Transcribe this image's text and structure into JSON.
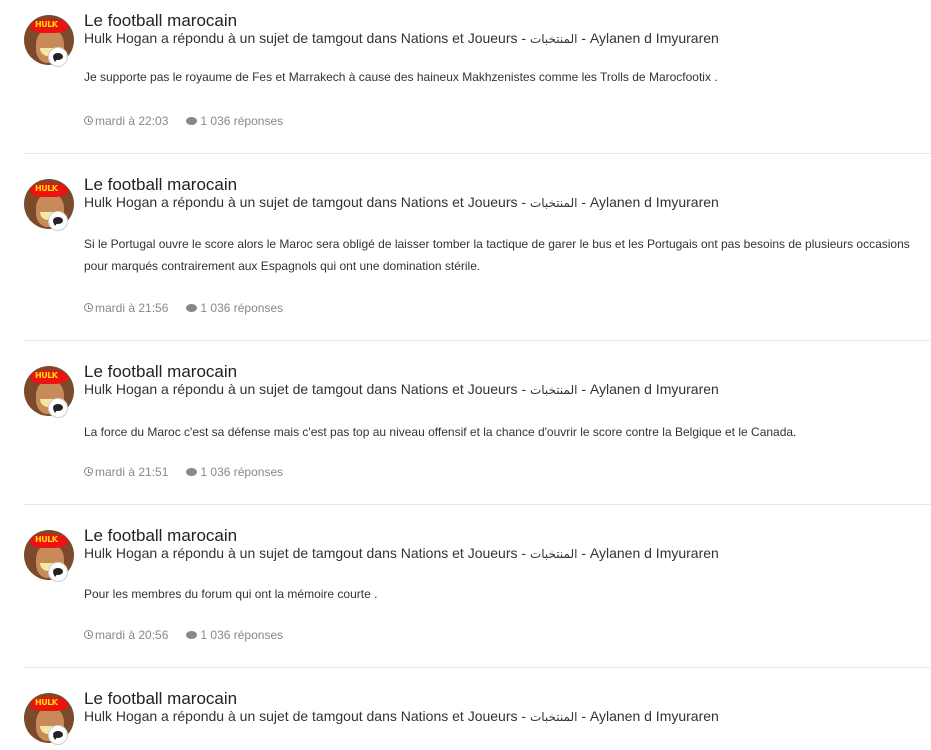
{
  "avatar_band_text": "HULK",
  "items": [
    {
      "forum": "Le football marocain",
      "summary": "Hulk Hogan a répondu à un sujet de tamgout dans Nations et Joueurs - ",
      "summary_ar": "المنتخبات",
      "summary_end": " - Aylanen d Imyuraren",
      "excerpt": "Je supporte pas le royaume de Fes et Marrakech à cause des haineux Makhzenistes comme les Trolls de Marocfootix .",
      "time": "mardi à 22:03",
      "replies": "1 036 réponses"
    },
    {
      "forum": "Le football marocain",
      "summary": "Hulk Hogan a répondu à un sujet de tamgout dans Nations et Joueurs - ",
      "summary_ar": "المنتخبات",
      "summary_end": " - Aylanen d Imyuraren",
      "excerpt": "Si le Portugal ouvre le score alors le Maroc sera obligé de laisser tomber la tactique de garer le bus et les Portugais ont pas besoins de plusieurs occasions pour marqués contrairement aux Espagnols qui ont une domination stérile.",
      "time": "mardi à 21:56",
      "replies": "1 036 réponses"
    },
    {
      "forum": "Le football marocain",
      "summary": "Hulk Hogan a répondu à un sujet de tamgout dans Nations et Joueurs - ",
      "summary_ar": "المنتخبات",
      "summary_end": " - Aylanen d Imyuraren",
      "excerpt": "La force du Maroc c'est sa défense mais c'est pas top au niveau offensif et la chance d'ouvrir le score contre la Belgique et le Canada.",
      "time": "mardi à 21:51",
      "replies": "1 036 réponses"
    },
    {
      "forum": "Le football marocain",
      "summary": "Hulk Hogan a répondu à un sujet de tamgout dans Nations et Joueurs - ",
      "summary_ar": "المنتخبات",
      "summary_end": " - Aylanen d Imyuraren",
      "excerpt": "Pour les membres du forum qui ont la mémoire courte .",
      "time": "mardi à 20:56",
      "replies": "1 036 réponses"
    },
    {
      "forum": "Le football marocain",
      "summary": "Hulk Hogan a répondu à un sujet de tamgout dans Nations et Joueurs - ",
      "summary_ar": "المنتخبات",
      "summary_end": " - Aylanen d Imyuraren"
    }
  ]
}
